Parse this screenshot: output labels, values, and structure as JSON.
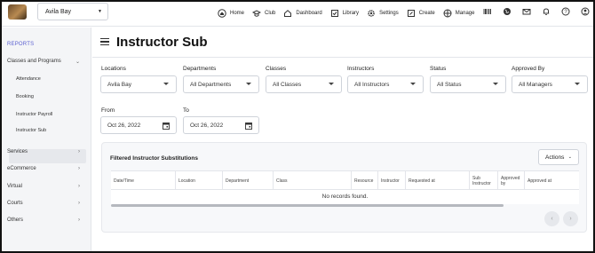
{
  "topbar": {
    "location": "Avila Bay",
    "nav": [
      {
        "label": "Home",
        "icon": "home-icon"
      },
      {
        "label": "Club",
        "icon": "club-icon"
      },
      {
        "label": "Dashboard",
        "icon": "dashboard-icon"
      },
      {
        "label": "Library",
        "icon": "library-icon"
      },
      {
        "label": "Settings",
        "icon": "gear-icon"
      },
      {
        "label": "Create",
        "icon": "create-icon"
      },
      {
        "label": "Manage",
        "icon": "manage-icon"
      }
    ],
    "right_icons": [
      "barcode-icon",
      "globe-icon",
      "mail-icon",
      "bell-icon",
      "help-icon",
      "user-icon"
    ]
  },
  "sidebar": {
    "section": "REPORTS",
    "group": "Classes and Programs",
    "sub": [
      "Attendance",
      "Booking",
      "Instructor Payroll",
      "Instructor Sub"
    ],
    "active": "Instructor Sub",
    "items": [
      "Services",
      "eCommerce",
      "Virtual",
      "Courts",
      "Others"
    ]
  },
  "page": {
    "title": "Instructor Sub"
  },
  "filters": {
    "locations": {
      "label": "Locations",
      "value": "Avila Bay"
    },
    "departments": {
      "label": "Departments",
      "value": "All Departments"
    },
    "classes": {
      "label": "Classes",
      "value": "All Classes"
    },
    "instructors": {
      "label": "Instructors",
      "value": "All Instructors"
    },
    "status": {
      "label": "Status",
      "value": "All Status"
    },
    "approved_by": {
      "label": "Approved By",
      "value": "All Managers"
    },
    "from": {
      "label": "From",
      "value": "Oct 26, 2022"
    },
    "to": {
      "label": "To",
      "value": "Oct 26, 2022"
    }
  },
  "table": {
    "title": "Filtered Instructor Substitutions",
    "actions_label": "Actions",
    "columns": [
      "Date/Time",
      "Location",
      "Department",
      "Class",
      "Resource",
      "Instructor",
      "Requested at",
      "Sub Instructor",
      "Approved by",
      "Approved at"
    ],
    "empty": "No records found."
  }
}
